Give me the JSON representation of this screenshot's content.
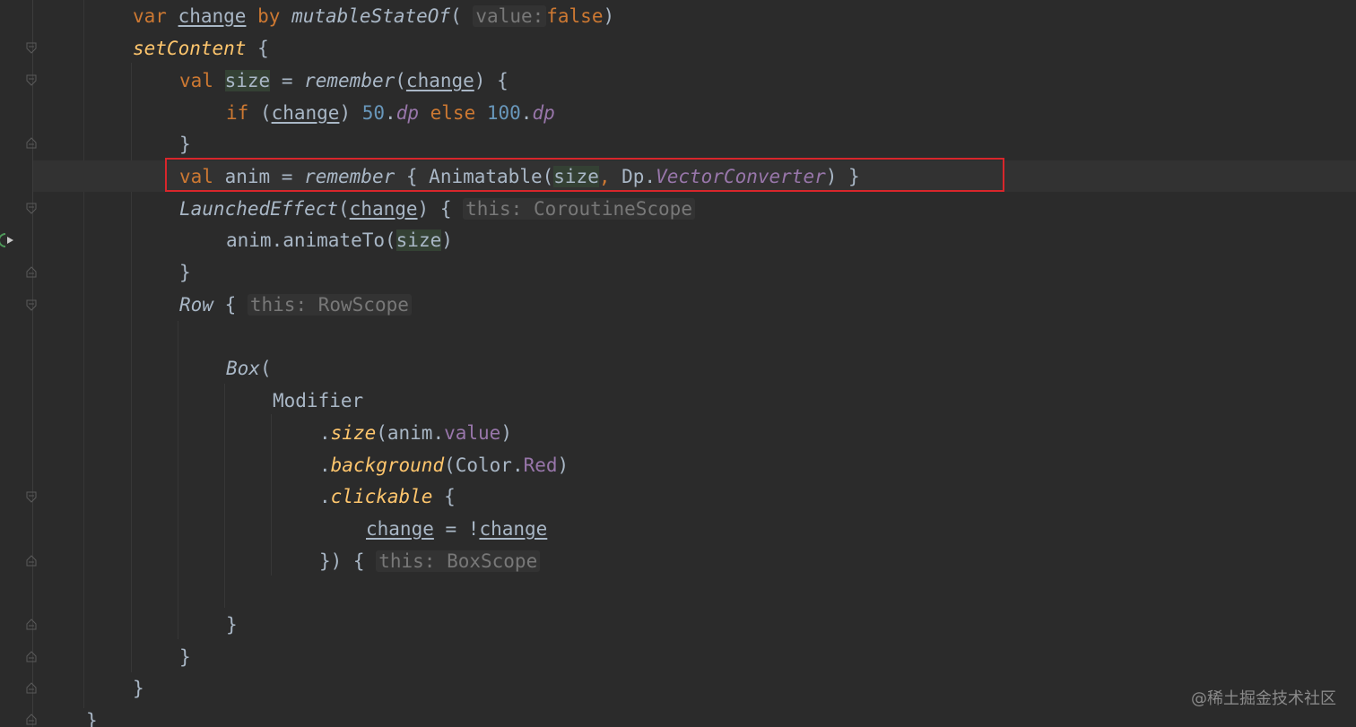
{
  "editor": {
    "code": {
      "l1": {
        "kw_var": "var",
        "name": "change",
        "kw_by": "by",
        "call": "mutableStateOf",
        "paren_open": "(",
        "hint": "value:",
        "arg": "false",
        "paren_close": ")"
      },
      "l2": {
        "call": "setContent",
        "brace": " {"
      },
      "l3": {
        "kw": "val",
        "name": "size",
        "eq": " = ",
        "call": "remember",
        "po": "(",
        "arg": "change",
        "pc": ") {"
      },
      "l4": {
        "kw_if": "if",
        "po": " (",
        "cond": "change",
        "pc": ") ",
        "n1": "50",
        "dot1": ".",
        "u1": "dp",
        "kw_else": " else ",
        "n2": "100",
        "dot2": ".",
        "u2": "dp"
      },
      "l5": {
        "text": "}"
      },
      "l6": {
        "kw": "val",
        "rest1": " anim = ",
        "call": "remember",
        "rest2": " { Animatable(",
        "arg": "size",
        "comma": ",",
        "rest3": " Dp.",
        "conv": "VectorConverter",
        "rest4": ") }"
      },
      "l7": {
        "call": "LaunchedEffect",
        "po": "(",
        "arg": "change",
        "pc": ") { ",
        "hint": "this: CoroutineScope"
      },
      "l8": {
        "pre": "anim.animateTo(",
        "arg": "size",
        "post": ")"
      },
      "l9": {
        "text": "}"
      },
      "l10": {
        "call": "Row",
        "brace": " { ",
        "hint": "this: RowScope"
      },
      "l11": {
        "call": "Box",
        "po": "("
      },
      "l12": {
        "text": "Modifier"
      },
      "l13": {
        "dot": ".",
        "call": "size",
        "pre": "(anim.",
        "prop": "value",
        "post": ")"
      },
      "l14": {
        "dot": ".",
        "call": "background",
        "pre": "(Color.",
        "prop": "Red",
        "post": ")"
      },
      "l15": {
        "dot": ".",
        "call": "clickable",
        "post": " {"
      },
      "l16": {
        "a": "change",
        "mid": " = !",
        "b": "change"
      },
      "l17": {
        "pre": "}) { ",
        "hint": "this: BoxScope"
      },
      "l18": {
        "text": "}"
      },
      "l19": {
        "text": "}"
      },
      "l20": {
        "text": "}"
      },
      "l21": {
        "text": "}"
      }
    },
    "gutter": {
      "run_icon": "run-gutter-icon",
      "fold_icon": "fold-marker-icon"
    }
  },
  "watermark": {
    "text": "@稀土掘金技术社区"
  },
  "colors": {
    "background": "#2b2b2b",
    "keyword": "#cc7832",
    "function": "#ffc66d",
    "property": "#9876aa",
    "number": "#6897bb",
    "text": "#a9b7c6",
    "highlight_box": "#d8262b"
  }
}
